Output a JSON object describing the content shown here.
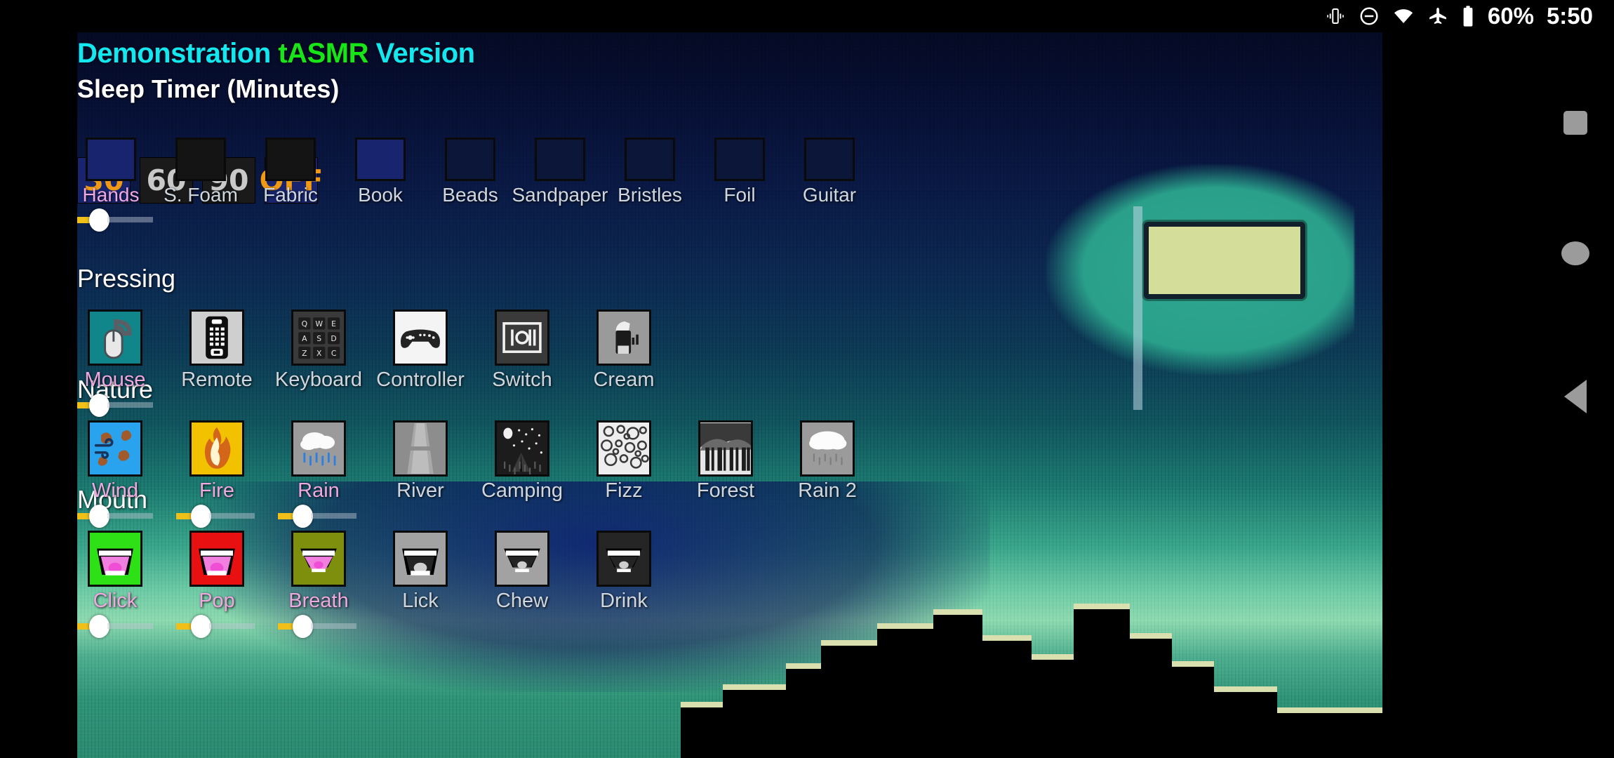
{
  "status_bar": {
    "icons": [
      "vibrate-icon",
      "do-not-disturb-icon",
      "wifi-icon",
      "airplane-mode-icon",
      "battery-icon"
    ],
    "battery_text": "60%",
    "time": "5:50"
  },
  "app": {
    "title_part1": "Demonstration ",
    "title_part2": "tASMR",
    "title_part3": " Version",
    "sleep_timer": {
      "heading": "Sleep Timer (Minutes)",
      "options": [
        {
          "label": "30",
          "selected": true
        },
        {
          "label": "60",
          "selected": false
        },
        {
          "label": "90",
          "selected": false
        },
        {
          "label": "OFF",
          "selected": true
        }
      ]
    },
    "sections": [
      {
        "name": "hands",
        "heading": "",
        "items": [
          {
            "label": "Hands",
            "icon": "hands-icon",
            "active": true,
            "slider": true
          },
          {
            "label": "S. Foam",
            "icon": "foam-icon",
            "active": false,
            "slider": false
          },
          {
            "label": "Fabric",
            "icon": "fabric-icon",
            "active": false,
            "slider": false
          },
          {
            "label": "Book",
            "icon": "book-icon",
            "active": false,
            "slider": false
          },
          {
            "label": "Beads",
            "icon": "beads-icon",
            "active": false,
            "slider": false
          },
          {
            "label": "Sandpaper",
            "icon": "sandpaper-icon",
            "active": false,
            "slider": false
          },
          {
            "label": "Bristles",
            "icon": "bristles-icon",
            "active": false,
            "slider": false
          },
          {
            "label": "Foil",
            "icon": "foil-icon",
            "active": false,
            "slider": false
          },
          {
            "label": "Guitar",
            "icon": "guitar-icon",
            "active": false,
            "slider": false
          }
        ]
      },
      {
        "name": "pressing",
        "heading": "Pressing",
        "items": [
          {
            "label": "Mouse",
            "icon": "mouse-icon",
            "active": true,
            "slider": true
          },
          {
            "label": "Remote",
            "icon": "remote-icon",
            "active": false,
            "slider": false
          },
          {
            "label": "Keyboard",
            "icon": "keyboard-icon",
            "active": false,
            "slider": false
          },
          {
            "label": "Controller",
            "icon": "controller-icon",
            "active": false,
            "slider": false
          },
          {
            "label": "Switch",
            "icon": "switch-icon",
            "active": false,
            "slider": false
          },
          {
            "label": "Cream",
            "icon": "cream-icon",
            "active": false,
            "slider": false
          }
        ]
      },
      {
        "name": "nature",
        "heading": "Nature",
        "items": [
          {
            "label": "Wind",
            "icon": "wind-icon",
            "active": true,
            "slider": true
          },
          {
            "label": "Fire",
            "icon": "fire-icon",
            "active": true,
            "slider": true
          },
          {
            "label": "Rain",
            "icon": "rain-icon",
            "active": true,
            "slider": true
          },
          {
            "label": "River",
            "icon": "river-icon",
            "active": false,
            "slider": false
          },
          {
            "label": "Camping",
            "icon": "camping-icon",
            "active": false,
            "slider": false
          },
          {
            "label": "Fizz",
            "icon": "fizz-icon",
            "active": false,
            "slider": false
          },
          {
            "label": "Forest",
            "icon": "forest-icon",
            "active": false,
            "slider": false
          },
          {
            "label": "Rain 2",
            "icon": "rain2-icon",
            "active": false,
            "slider": false
          }
        ]
      },
      {
        "name": "mouth",
        "heading": "Mouth",
        "items": [
          {
            "label": "Click",
            "icon": "click-mouth-icon",
            "active": true,
            "slider": true
          },
          {
            "label": "Pop",
            "icon": "pop-mouth-icon",
            "active": true,
            "slider": true
          },
          {
            "label": "Breath",
            "icon": "breath-mouth-icon",
            "active": true,
            "slider": true
          },
          {
            "label": "Lick",
            "icon": "lick-mouth-icon",
            "active": false,
            "slider": false
          },
          {
            "label": "Chew",
            "icon": "chew-mouth-icon",
            "active": false,
            "slider": false
          },
          {
            "label": "Drink",
            "icon": "drink-mouth-icon",
            "active": false,
            "slider": false
          }
        ]
      }
    ]
  },
  "nav_bar": {
    "recents_label": "recents",
    "home_label": "home",
    "back_label": "back"
  },
  "colors": {
    "title_cyan": "#13e8f0",
    "title_green": "#17e517",
    "selected_button_bg": "#18256e",
    "selected_button_text": "#f09a14",
    "unselected_button_bg": "#1a1a1a",
    "unselected_button_text": "#c9c9c9",
    "active_label": "#f0a8e0",
    "inactive_label": "#cfd6dd",
    "slider_fill": "#f0c018",
    "slider_thumb": "#ffffff"
  }
}
